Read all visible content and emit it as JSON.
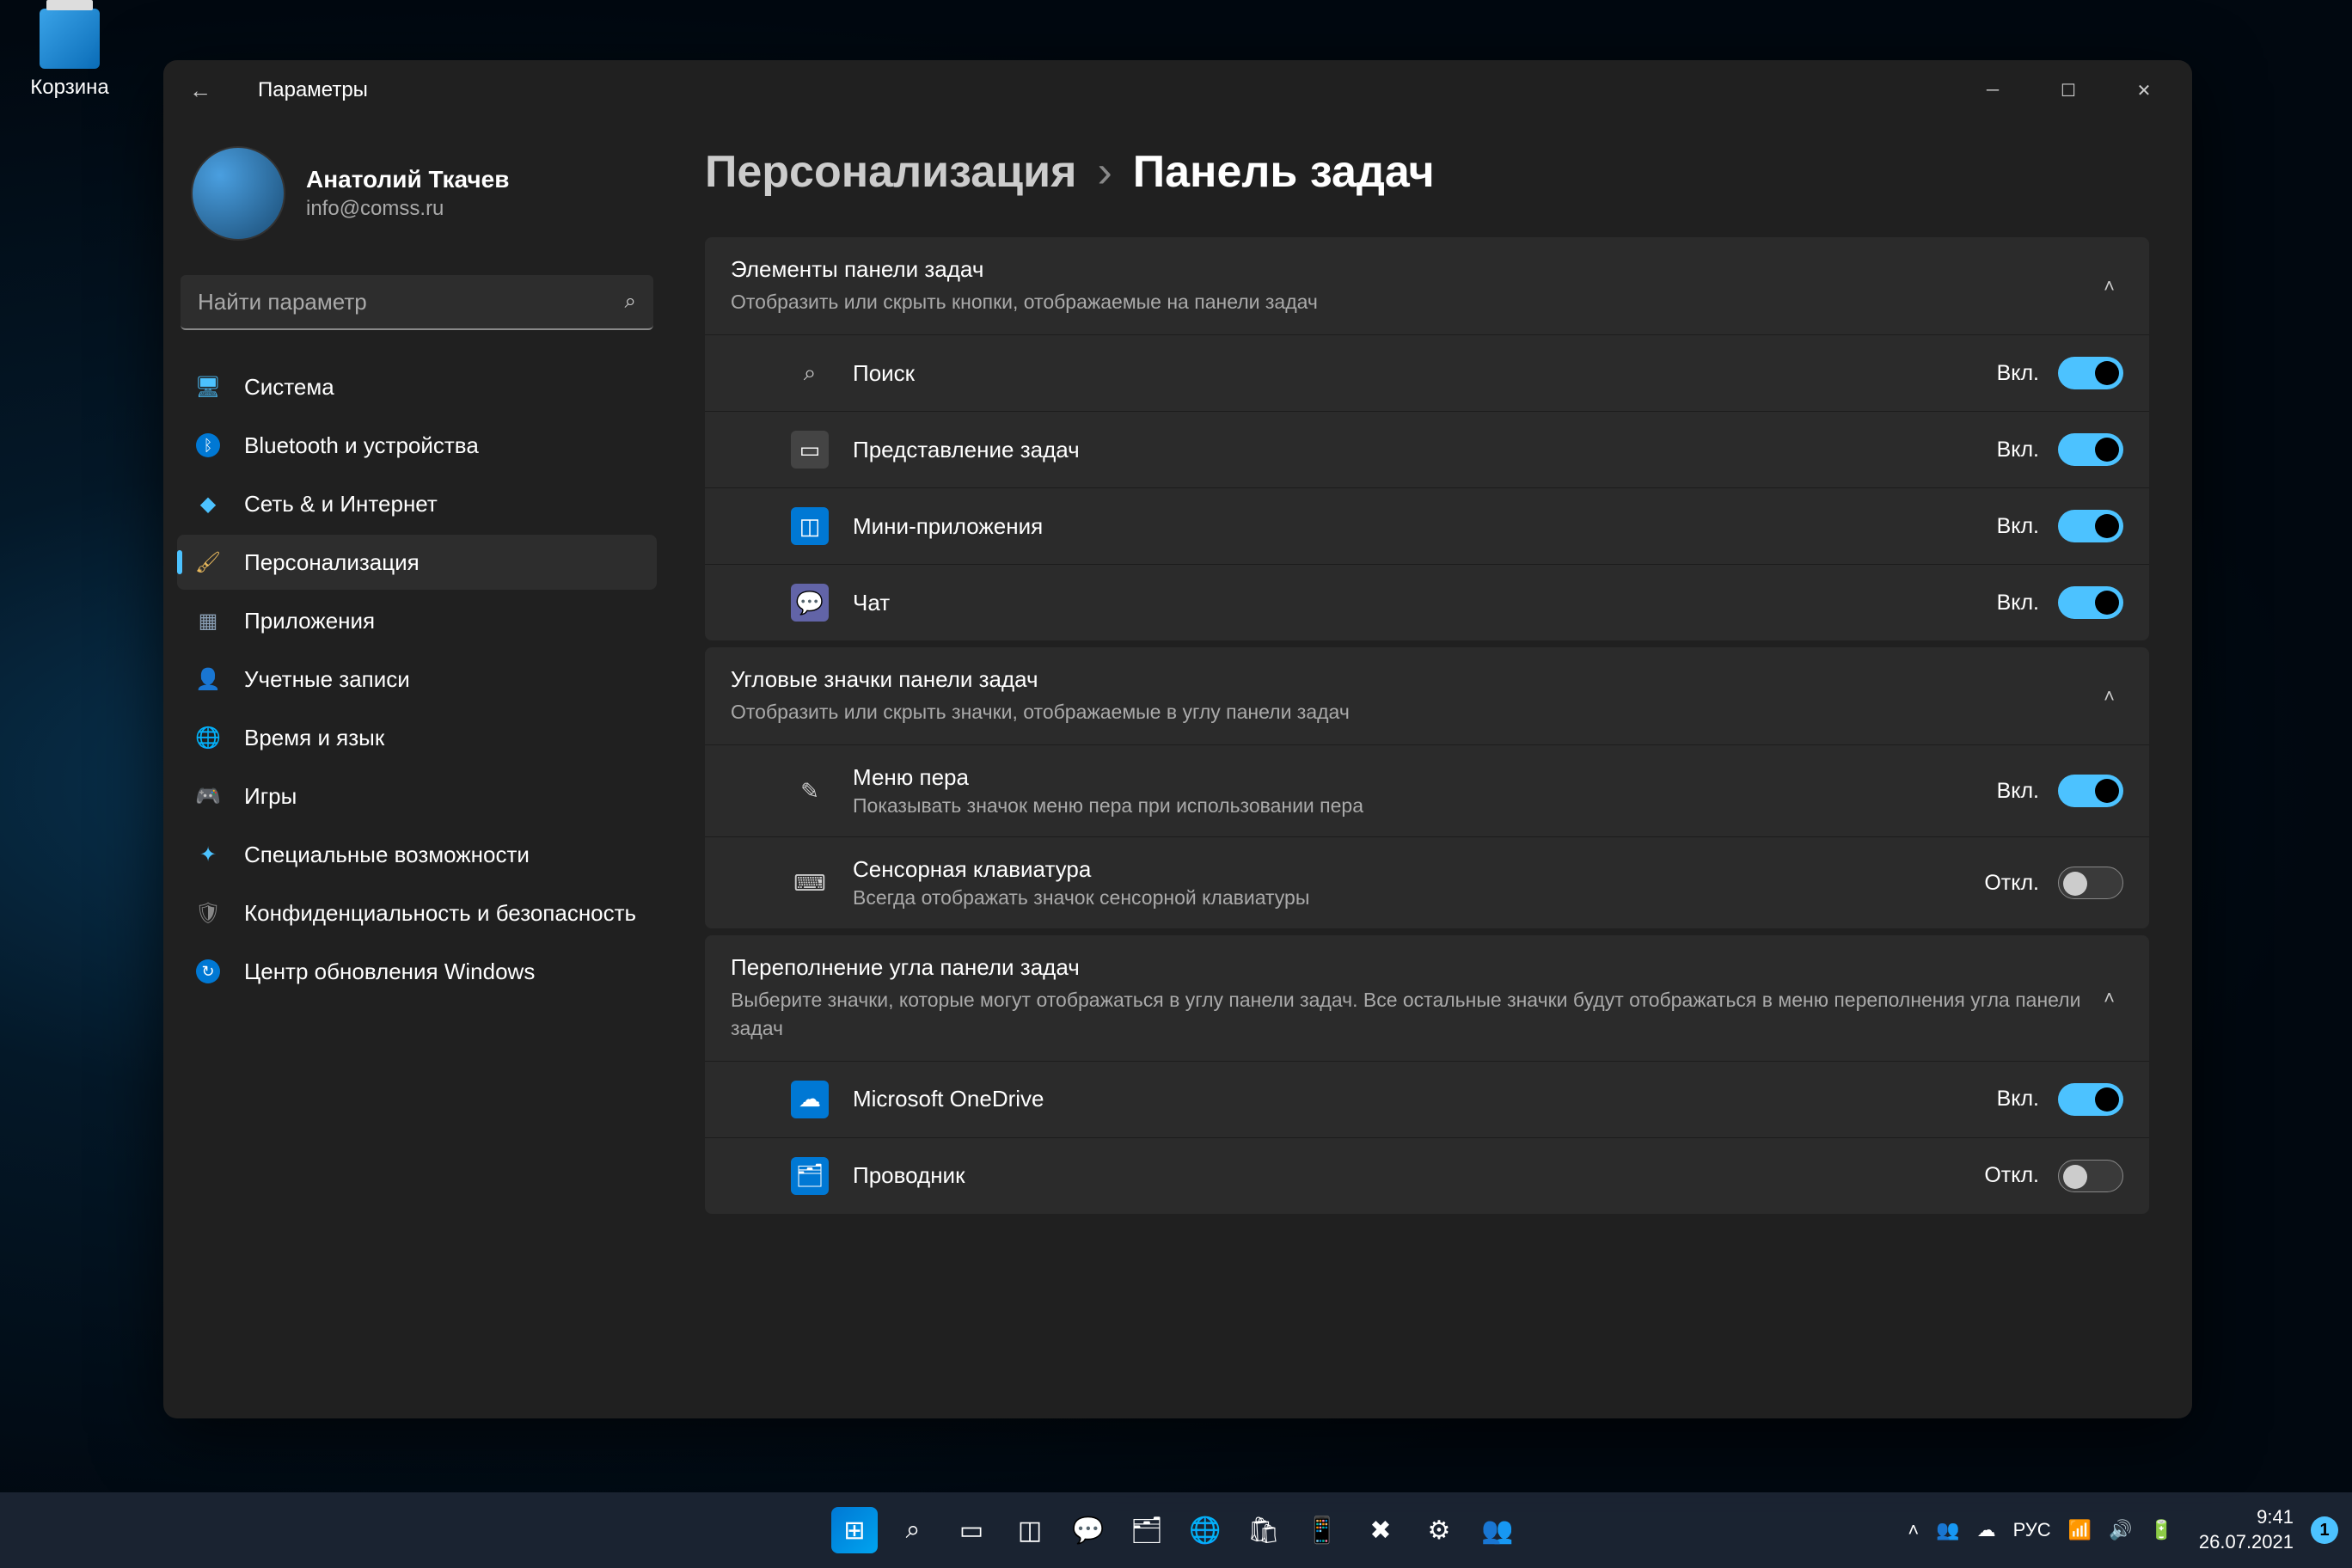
{
  "desktop": {
    "recycle_bin": "Корзина"
  },
  "window": {
    "title": "Параметры",
    "user": {
      "name": "Анатолий Ткачев",
      "email": "info@comss.ru"
    },
    "search_placeholder": "Найти параметр",
    "nav": [
      {
        "label": "Система"
      },
      {
        "label": "Bluetooth и устройства"
      },
      {
        "label": "Сеть & и Интернет"
      },
      {
        "label": "Персонализация"
      },
      {
        "label": "Приложения"
      },
      {
        "label": "Учетные записи"
      },
      {
        "label": "Время и язык"
      },
      {
        "label": "Игры"
      },
      {
        "label": "Специальные возможности"
      },
      {
        "label": "Конфиденциальность и безопасность"
      },
      {
        "label": "Центр обновления Windows"
      }
    ],
    "breadcrumb": {
      "parent": "Персонализация",
      "current": "Панель задач"
    },
    "state_on": "Вкл.",
    "state_off": "Откл.",
    "sections": [
      {
        "title": "Элементы панели задач",
        "subtitle": "Отобразить или скрыть кнопки, отображаемые на панели задач",
        "rows": [
          {
            "label": "Поиск",
            "on": true
          },
          {
            "label": "Представление задач",
            "on": true
          },
          {
            "label": "Мини-приложения",
            "on": true
          },
          {
            "label": "Чат",
            "on": true
          }
        ]
      },
      {
        "title": "Угловые значки панели задач",
        "subtitle": "Отобразить или скрыть значки, отображаемые в углу панели задач",
        "rows": [
          {
            "label": "Меню пера",
            "sub": "Показывать значок меню пера при использовании пера",
            "on": true
          },
          {
            "label": "Сенсорная клавиатура",
            "sub": "Всегда отображать значок сенсорной клавиатуры",
            "on": false
          }
        ]
      },
      {
        "title": "Переполнение угла панели задач",
        "subtitle": "Выберите значки, которые могут отображаться в углу панели задач. Все остальные значки будут отображаться в меню переполнения угла панели задач",
        "rows": [
          {
            "label": "Microsoft OneDrive",
            "on": true
          },
          {
            "label": "Проводник",
            "on": false
          }
        ]
      }
    ]
  },
  "taskbar": {
    "lang": "РУС",
    "time": "9:41",
    "date": "26.07.2021",
    "notif_count": "1"
  }
}
